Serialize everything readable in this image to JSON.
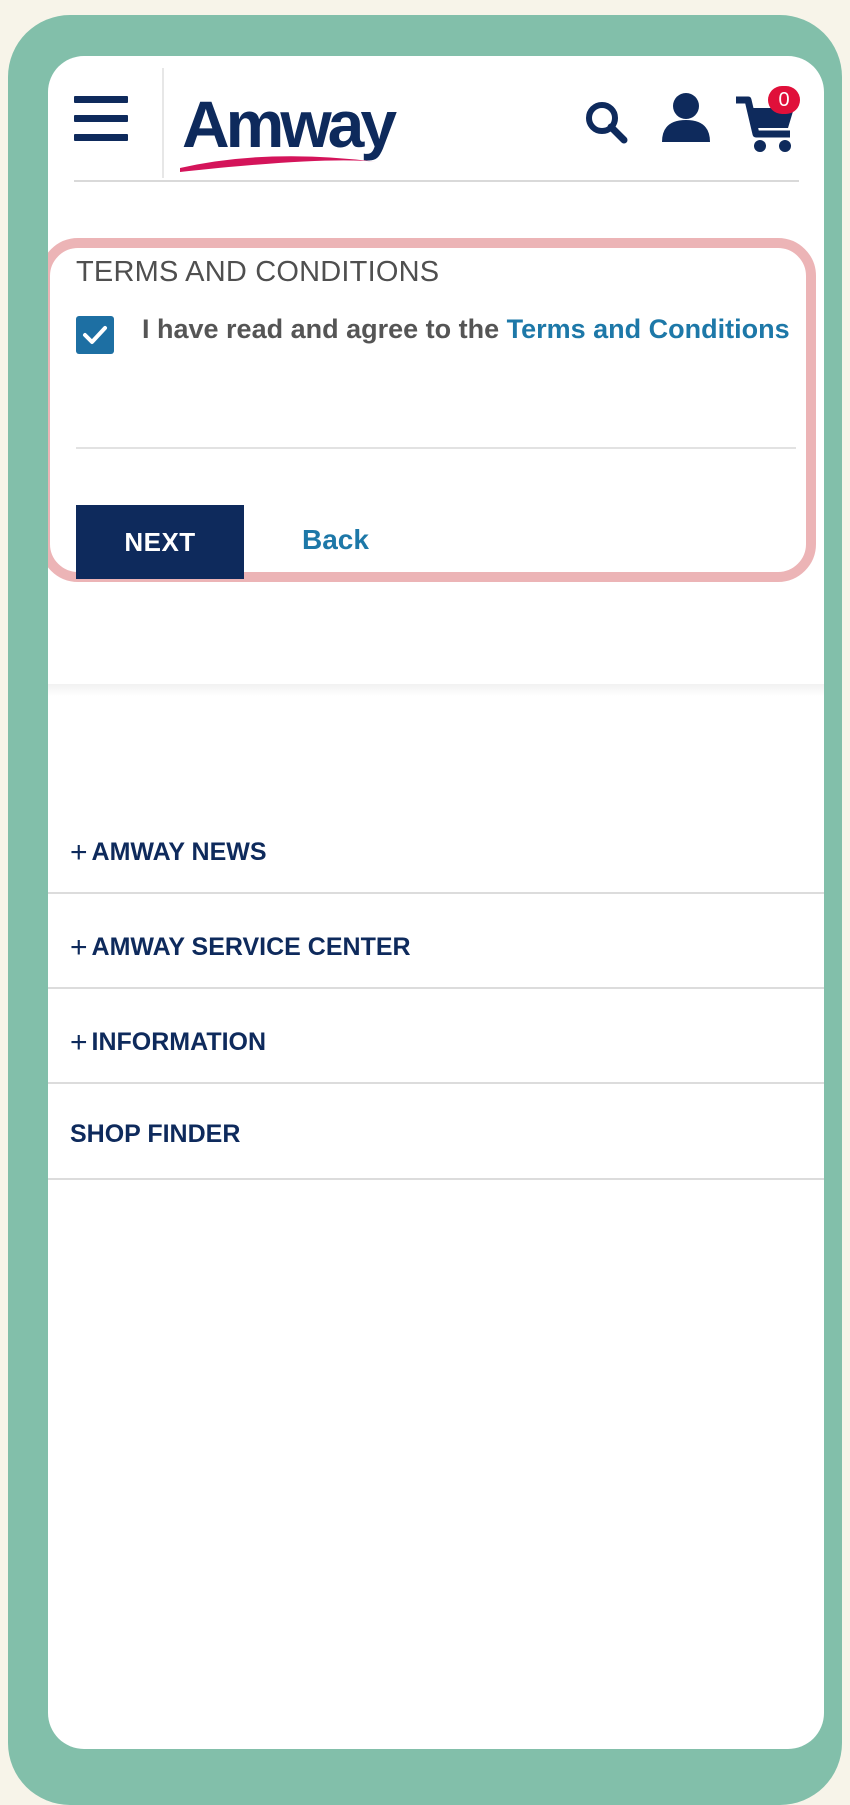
{
  "header": {
    "logo_text": "Amway",
    "cart_count": "0",
    "icons": [
      "menu-icon",
      "search-icon",
      "account-icon",
      "cart-icon"
    ]
  },
  "terms": {
    "title": "TERMS AND CONDITIONS",
    "checkbox_checked": true,
    "agree_text": "I have read and agree to the ",
    "agree_link": "Terms and Conditions",
    "next_label": "NEXT",
    "back_label": "Back"
  },
  "footer": {
    "items": [
      {
        "prefix": "+",
        "label": "AMWAY NEWS"
      },
      {
        "prefix": "+",
        "label": "AMWAY SERVICE CENTER"
      },
      {
        "prefix": "+",
        "label": "INFORMATION"
      },
      {
        "prefix": "",
        "label": "SHOP FINDER"
      }
    ]
  },
  "colors": {
    "brand_navy": "#0e2a5c",
    "link_blue": "#1d78a8",
    "badge_red": "#e0103a",
    "frame_green": "#82bfaa",
    "highlight_pink": "#ecb4b6"
  }
}
